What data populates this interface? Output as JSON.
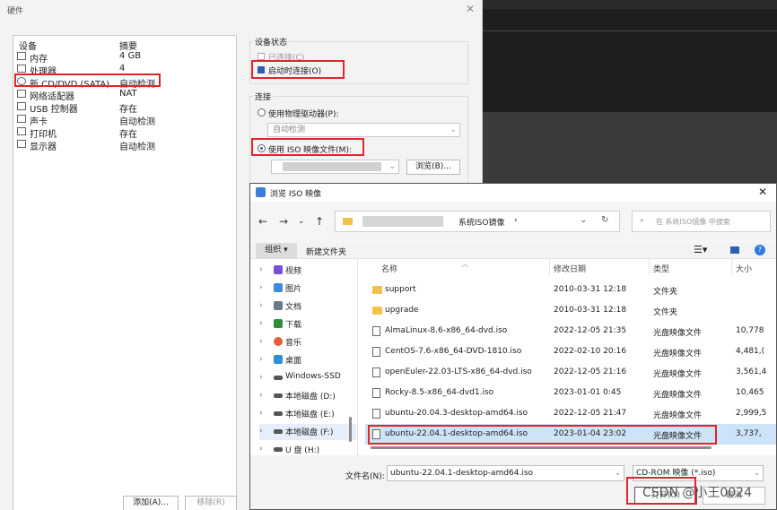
{
  "hardware": {
    "title": "硬件",
    "headers": {
      "device": "设备",
      "summary": "摘要"
    },
    "devices": [
      {
        "name": "内存",
        "summary": "4 GB"
      },
      {
        "name": "处理器",
        "summary": "4"
      },
      {
        "name": "新 CD/DVD (SATA)",
        "summary": "自动检测"
      },
      {
        "name": "网络适配器",
        "summary": "NAT"
      },
      {
        "name": "USB 控制器",
        "summary": "存在"
      },
      {
        "name": "声卡",
        "summary": "自动检测"
      },
      {
        "name": "打印机",
        "summary": "存在"
      },
      {
        "name": "显示器",
        "summary": "自动检测"
      }
    ],
    "add_button": "添加(A)...",
    "remove_button": "移除(R)",
    "device_status": {
      "title": "设备状态",
      "connected": "已连接(C)",
      "connect_on_power_on": "启动时连接(O)"
    },
    "connection": {
      "title": "连接",
      "physical_drive": "使用物理驱动器(P):",
      "physical_drive_value": "自动检测",
      "iso_image": "使用 ISO 映像文件(M):",
      "browse_button": "浏览(B)..."
    }
  },
  "iso_dialog": {
    "title": "浏览 ISO 映像",
    "breadcrumb_folder": "系统ISO镜像",
    "search_placeholder": "在 系统ISO镜像 中搜索",
    "organize": "组织",
    "new_folder": "新建文件夹",
    "nav_items": [
      {
        "label": "视频",
        "color": "#7a4fd6"
      },
      {
        "label": "图片",
        "color": "#3a8de0"
      },
      {
        "label": "文档",
        "color": "#6a7a8a"
      },
      {
        "label": "下载",
        "color": "#2d8f3a"
      },
      {
        "label": "音乐",
        "color": "#e0603a"
      },
      {
        "label": "桌面",
        "color": "#2f8fd8"
      },
      {
        "label": "Windows-SSD",
        "color": "#555555"
      },
      {
        "label": "本地磁盘 (D:)",
        "color": "#555555"
      },
      {
        "label": "本地磁盘 (E:)",
        "color": "#555555"
      },
      {
        "label": "本地磁盘 (F:)",
        "color": "#555555"
      },
      {
        "label": "U 盘 (H:)",
        "color": "#555555"
      }
    ],
    "columns": {
      "name": "名称",
      "modified": "修改日期",
      "type": "类型",
      "size": "大小"
    },
    "files": [
      {
        "name": "support",
        "date": "2010-03-31 12:18",
        "type": "文件夹",
        "size": "",
        "folder": true
      },
      {
        "name": "upgrade",
        "date": "2010-03-31 12:18",
        "type": "文件夹",
        "size": "",
        "folder": true
      },
      {
        "name": "AlmaLinux-8.6-x86_64-dvd.iso",
        "date": "2022-12-05 21:35",
        "type": "光盘映像文件",
        "size": "10,778",
        "folder": false
      },
      {
        "name": "CentOS-7.6-x86_64-DVD-1810.iso",
        "date": "2022-02-10 20:16",
        "type": "光盘映像文件",
        "size": "4,481,(",
        "folder": false
      },
      {
        "name": "openEuler-22.03-LTS-x86_64-dvd.iso",
        "date": "2022-12-05 21:16",
        "type": "光盘映像文件",
        "size": "3,561,4",
        "folder": false
      },
      {
        "name": "Rocky-8.5-x86_64-dvd1.iso",
        "date": "2023-01-01 0:45",
        "type": "光盘映像文件",
        "size": "10,465",
        "folder": false
      },
      {
        "name": "ubuntu-20.04.3-desktop-amd64.iso",
        "date": "2022-12-05 21:47",
        "type": "光盘映像文件",
        "size": "2,999,5",
        "folder": false
      },
      {
        "name": "ubuntu-22.04.1-desktop-amd64.iso",
        "date": "2023-01-04 23:02",
        "type": "光盘映像文件",
        "size": "3,737,",
        "folder": false
      }
    ],
    "filename_label": "文件名(N):",
    "filename_value": "ubuntu-22.04.1-desktop-amd64.iso",
    "filetype_value": "CD-ROM 映像 (*.iso)",
    "open_button": "打开(O)",
    "cancel_button": "取消"
  },
  "watermark": "CSDN @小王0024"
}
